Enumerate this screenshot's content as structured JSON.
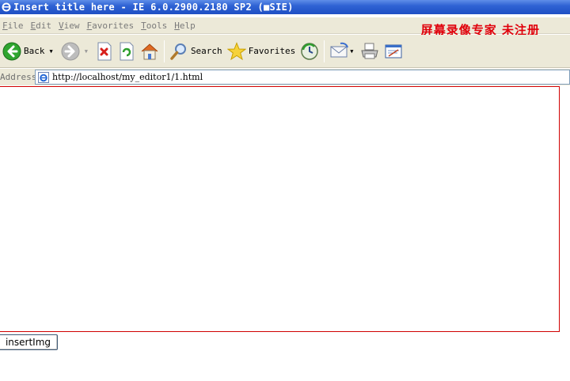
{
  "window": {
    "title": "Insert title here - IE 6.0.2900.2180 SP2 (■SIE)"
  },
  "menu": {
    "items": [
      {
        "first": "F",
        "rest": "ile"
      },
      {
        "first": "E",
        "rest": "dit"
      },
      {
        "first": "V",
        "rest": "iew"
      },
      {
        "first": "F",
        "rest": "avorites"
      },
      {
        "first": "T",
        "rest": "ools"
      },
      {
        "first": "H",
        "rest": "elp"
      }
    ]
  },
  "watermark": "屏幕录像专家 未注册",
  "toolbar": {
    "back_label": "Back",
    "search_label": "Search",
    "favorites_label": "Favorites"
  },
  "address": {
    "label": "Address",
    "value": "http://localhost/my_editor1/1.html"
  },
  "page": {
    "insert_button_label": "insertImg"
  },
  "colors": {
    "titlebar": "#2f63d4",
    "chrome": "#ece9d8",
    "watermark": "#e0000b",
    "frame_border": "#d00000"
  }
}
